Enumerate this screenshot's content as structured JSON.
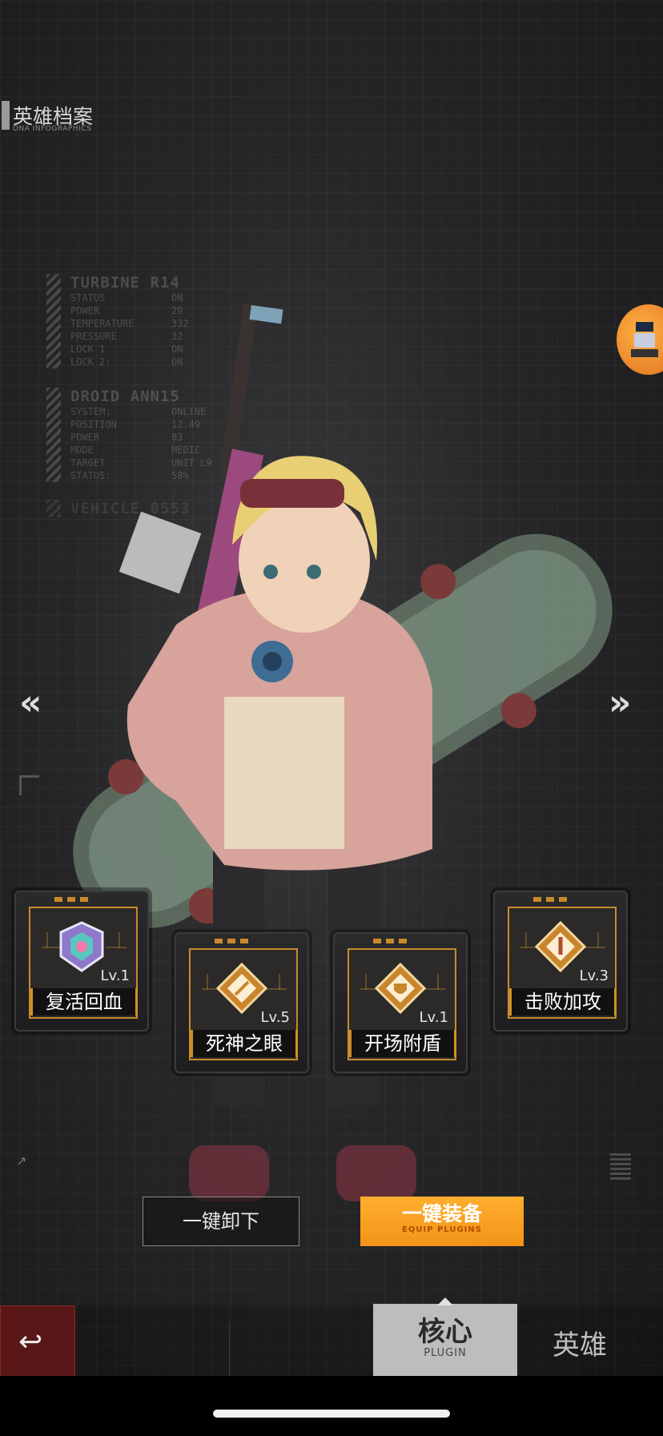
{
  "header": {
    "title": "英雄档案",
    "subtitle": "DNA INFOGRAPHICS"
  },
  "infoboxes": [
    {
      "name": "TURBINE R14",
      "rows": [
        [
          "STATUS",
          "ON"
        ],
        [
          "POWER",
          "29"
        ],
        [
          "TEMPERATURE",
          "332"
        ],
        [
          "PRESSURE",
          "32"
        ],
        [
          "LOCK 1",
          "ON"
        ],
        [
          "LOCK 2:",
          "ON"
        ]
      ]
    },
    {
      "name": "DROID ANN15",
      "rows": [
        [
          "SYSTEM:",
          "ONLINE"
        ],
        [
          "POSITION",
          "12.49"
        ],
        [
          "POWER",
          "83"
        ],
        [
          "MODE",
          "MEDIC"
        ],
        [
          "TARGET",
          "UNIT L9"
        ],
        [
          "STATUS:",
          "58%"
        ]
      ]
    },
    {
      "name": "VEHICLE 0553",
      "rows": []
    }
  ],
  "nav": {
    "prev_label": "«",
    "next_label": "»"
  },
  "plugins": [
    {
      "name": "复活回血",
      "level": "Lv.1",
      "emblem_color": "#b58be0"
    },
    {
      "name": "死神之眼",
      "level": "Lv.5",
      "emblem_color": "#e0a040"
    },
    {
      "name": "开场附盾",
      "level": "Lv.1",
      "emblem_color": "#e0a040"
    },
    {
      "name": "击败加攻",
      "level": "Lv.3",
      "emblem_color": "#e0a040"
    }
  ],
  "buttons": {
    "unequip_all": "一键卸下",
    "equip_all": "一键装备",
    "equip_all_sub": "EQUIP PLUGINS"
  },
  "bottom_nav": {
    "back_icon": "↩",
    "core_tab": "核心",
    "core_tab_sub": "PLUGIN",
    "hero_tab": "英雄"
  },
  "colors": {
    "accent": "#f29417",
    "card_border": "#c98a2c",
    "back_button": "#5a1717"
  }
}
